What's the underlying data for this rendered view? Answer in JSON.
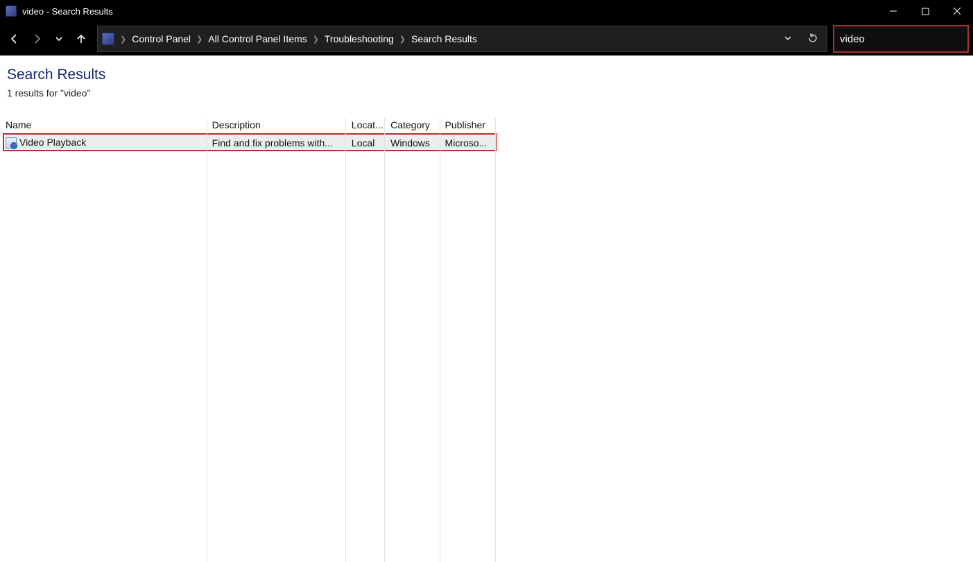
{
  "window": {
    "title": "video - Search Results"
  },
  "breadcrumb": {
    "items": [
      "Control Panel",
      "All Control Panel Items",
      "Troubleshooting",
      "Search Results"
    ]
  },
  "search": {
    "value": "video"
  },
  "page": {
    "heading": "Search Results",
    "results_summary": "1 results for \"video\""
  },
  "columns": {
    "name": "Name",
    "description": "Description",
    "location": "Locat...",
    "category": "Category",
    "publisher": "Publisher"
  },
  "rows": [
    {
      "name": "Video Playback",
      "description": "Find and fix problems with...",
      "location": "Local",
      "category": "Windows",
      "publisher": "Microso..."
    }
  ]
}
